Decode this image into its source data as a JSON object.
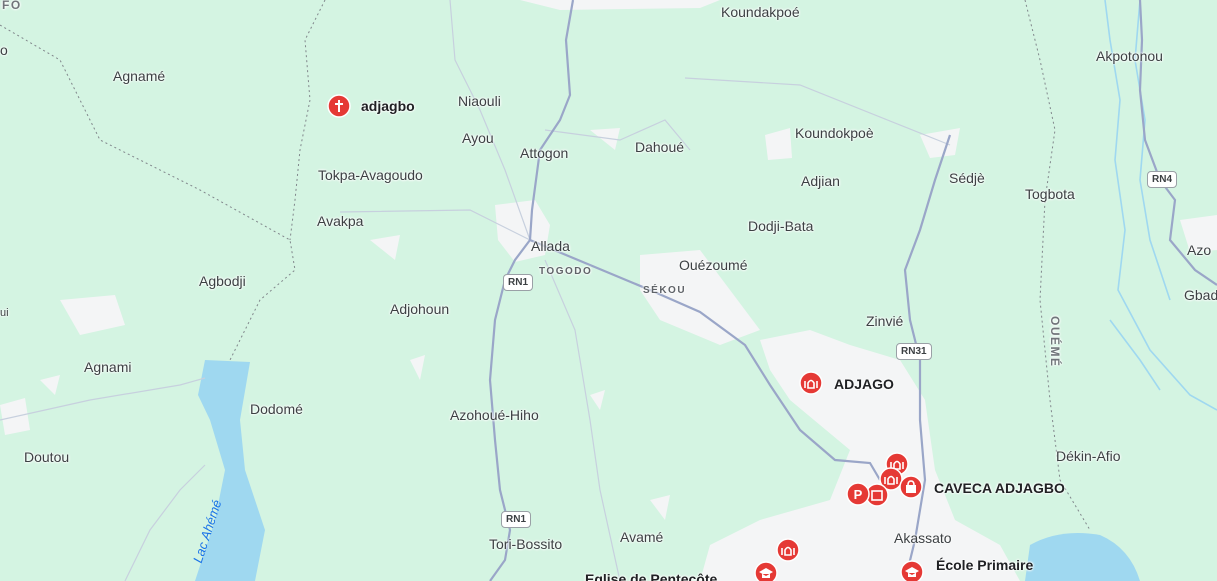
{
  "colors": {
    "land": "#d4f4e2",
    "urban": "#f4f5f6",
    "water": "#9fd8f0",
    "road": "#9aa6c8",
    "pin": "#e53935"
  },
  "places": {
    "koundakpoe": "Koundakpoé",
    "akpotonou": "Akpotonou",
    "agname": "Agnamé",
    "niaouli": "Niaouli",
    "ayou": "Ayou",
    "attogon": "Attogon",
    "dahoue": "Dahoué",
    "koundokpoe": "Koundokpoè",
    "sedje": "Sédjè",
    "adjian": "Adjian",
    "togbota": "Togbota",
    "tokpa_avagoudo": "Tokpa-Avagoudo",
    "avakpa": "Avakpa",
    "allada": "Allada",
    "dodji_bata": "Dodji-Bata",
    "azo": "Azo",
    "ouezoume": "Ouézoumé",
    "gbad": "Gbad",
    "agbodji": "Agbodji",
    "adjohoun": "Adjohoun",
    "zinvie": "Zinvié",
    "agnami": "Agnami",
    "dodome": "Dodomé",
    "azohoue_hiho": "Azohoué-Hiho",
    "doutou": "Doutou",
    "dekin_afio": "Dékin-Afio",
    "avame": "Avamé",
    "akassato": "Akassato",
    "tori_bossito": "Tori-Bossito",
    "eglise": "Eglise de Pentecôte",
    "edge_left_top": "o",
    "edge_left_mid": "ui",
    "edge_top_fo": "FO"
  },
  "districts": {
    "togodo": "TOGODO",
    "sekou": "SÉKOU",
    "oueme": "OUÉMÉ"
  },
  "pois": {
    "adjagbo": "adjagbo",
    "adjago": "ADJAGO",
    "caveca": "CAVECA ADJAGBO",
    "ecole": "École Primaire"
  },
  "roads": {
    "rn1_a": "RN1",
    "rn1_b": "RN1",
    "rn31": "RN31",
    "rn4": "RN4"
  },
  "water": {
    "lake": "Lac Ahémé"
  }
}
